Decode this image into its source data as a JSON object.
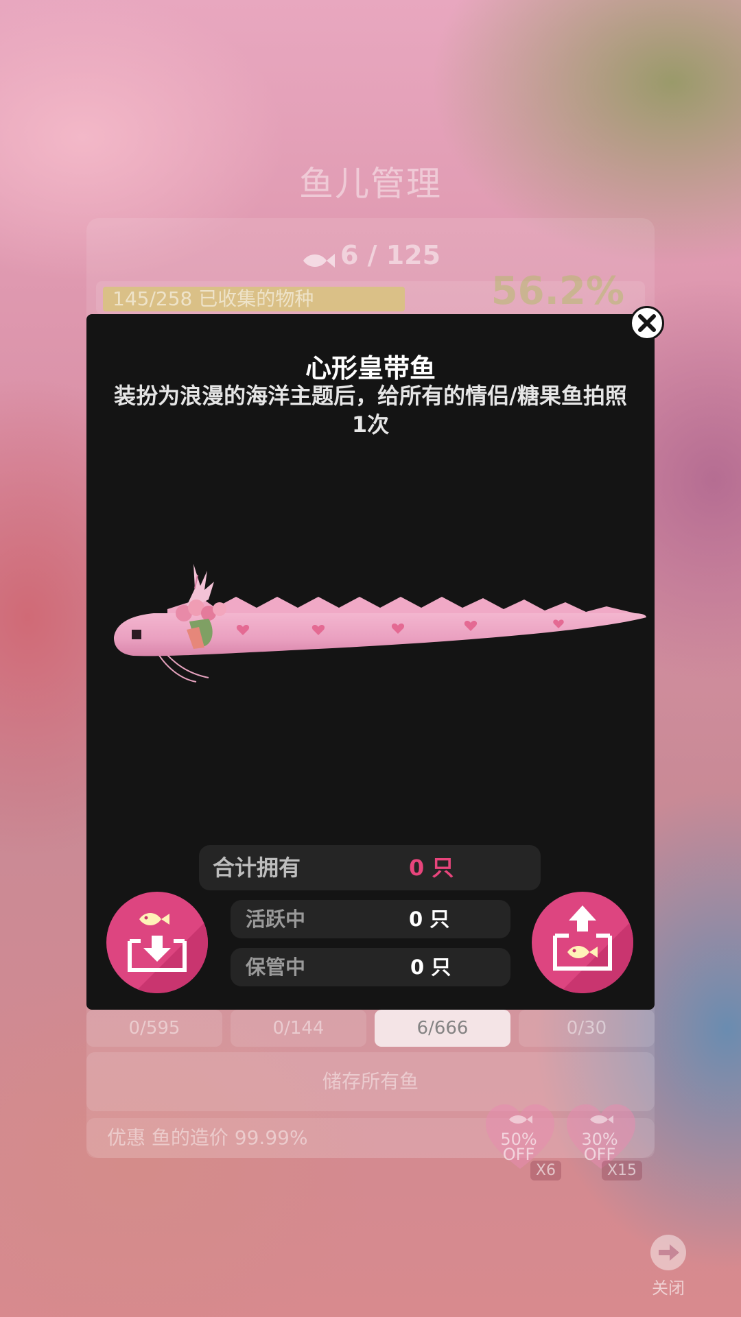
{
  "background": {
    "title": "鱼儿管理",
    "fish_count": "6 / 125",
    "progress_text": "145/258 已收集的物种",
    "progress_fraction": 0.562,
    "percent": "56.2%",
    "tabs": [
      "0/595",
      "0/144",
      "6/666",
      "0/30"
    ],
    "active_tab_index": 2,
    "store_all_label": "储存所有鱼",
    "discount_text": "优惠 鱼的造价 99.99%",
    "coupons": [
      {
        "line1": "50%",
        "line2": "OFF",
        "multiplier": "X6"
      },
      {
        "line1": "30%",
        "line2": "OFF",
        "multiplier": "X15"
      }
    ],
    "close_label": "关闭"
  },
  "modal": {
    "title": "心形皇带鱼",
    "description": "装扮为浪漫的海洋主题后，给所有的情侣/糖果鱼拍照1次",
    "total_label": "合计拥有",
    "total_value": "0 只",
    "active_label": "活跃中",
    "active_value": "0 只",
    "stored_label": "保管中",
    "stored_value": "0 只"
  },
  "colors": {
    "modal_bg": "#141414",
    "accent_pink": "#dd4580",
    "value_pink": "#e8457c",
    "row_bg": "#252525"
  }
}
